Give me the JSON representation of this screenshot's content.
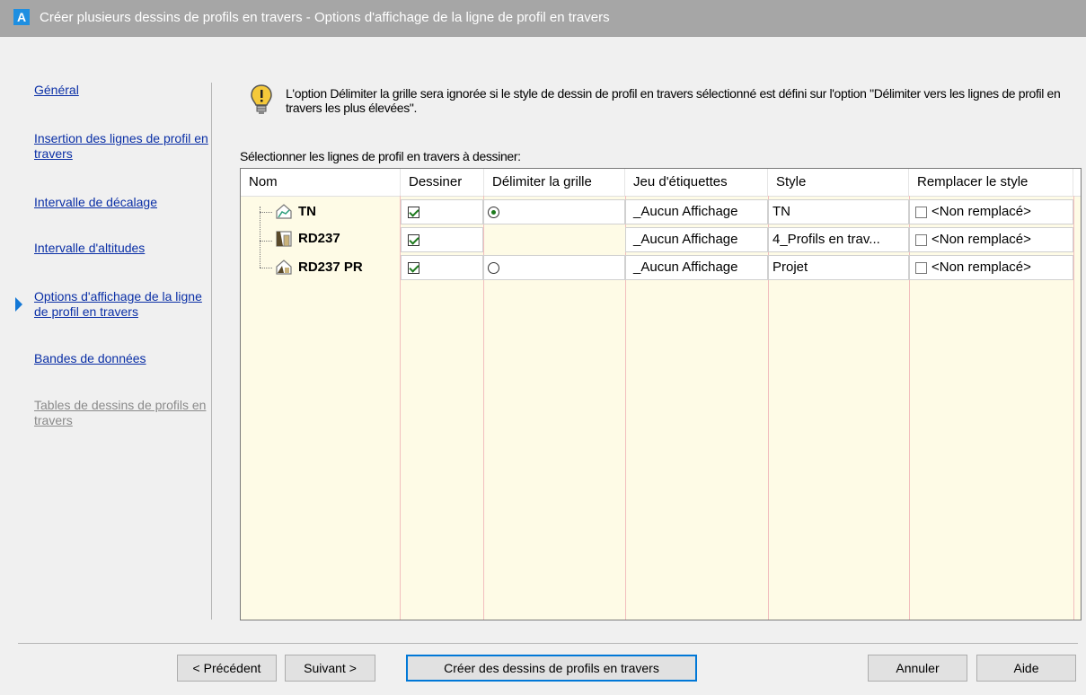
{
  "window": {
    "title": "Créer plusieurs dessins de profils en travers - Options d'affichage de la ligne de profil en travers"
  },
  "nav": {
    "items": [
      {
        "label": "Général"
      },
      {
        "label": "Insertion des lignes de profil en travers"
      },
      {
        "label": "Intervalle de décalage"
      },
      {
        "label": "Intervalle d'altitudes"
      },
      {
        "label": "Options d'affichage de la ligne de profil en travers"
      },
      {
        "label": "Bandes de données"
      },
      {
        "label": "Tables de dessins de profils en travers"
      }
    ]
  },
  "main": {
    "warning": "L'option Délimiter la grille sera ignorée si le style de dessin de profil en travers sélectionné est défini sur l'option \"Délimiter vers les lignes de profil en travers les plus élevées\".",
    "select_label": "Sélectionner les lignes de profil en travers à dessiner:",
    "table": {
      "columns": [
        "Nom",
        "Dessiner",
        "Délimiter la grille",
        "Jeu d'étiquettes",
        "Style",
        "Remplacer le style"
      ],
      "rows": [
        {
          "name": "TN",
          "draw": true,
          "clip": "selected",
          "label_set": "_Aucun Affichage",
          "style": "TN",
          "override": false,
          "override_label": "<Non remplacé>"
        },
        {
          "name": "RD237",
          "draw": true,
          "clip": "none",
          "label_set": "_Aucun Affichage",
          "style": "4_Profils en trav...",
          "override": false,
          "override_label": "<Non remplacé>"
        },
        {
          "name": "RD237 PR",
          "draw": true,
          "clip": "unselected",
          "label_set": "_Aucun Affichage",
          "style": "Projet",
          "override": false,
          "override_label": "<Non remplacé>"
        }
      ]
    }
  },
  "footer": {
    "prev": "< Précédent",
    "next": "Suivant >",
    "create": "Créer des dessins de profils en travers",
    "cancel": "Annuler",
    "help": "Aide"
  }
}
